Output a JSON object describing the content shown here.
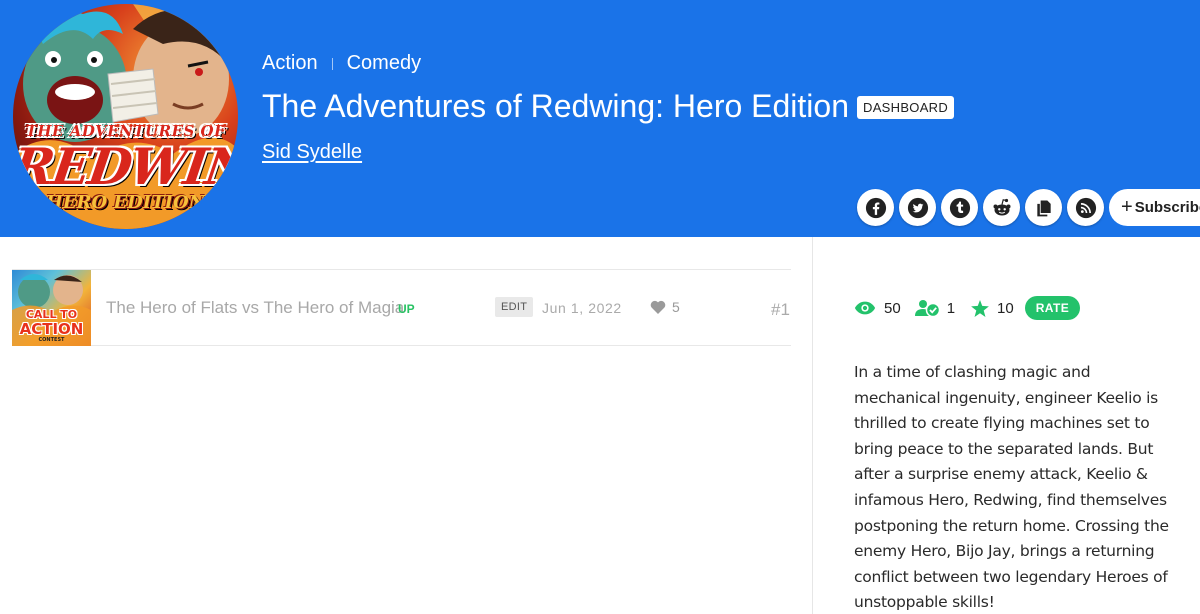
{
  "series": {
    "genres": [
      "Action",
      "Comedy"
    ],
    "title": "The Adventures of Redwing: Hero Edition",
    "dashboard_label": "DASHBOARD",
    "author": "Sid Sydelle",
    "cover_logo": {
      "top": "THE ADVENTURES OF",
      "main": "REDWING",
      "sub": "HERO EDITION"
    }
  },
  "social": {
    "icons": [
      "facebook-icon",
      "twitter-icon",
      "tumblr-icon",
      "reddit-icon",
      "copy-link-icon",
      "rss-icon"
    ],
    "subscribe_label": "Subscribe"
  },
  "episodes": [
    {
      "title": "The Hero of Flats vs The Hero of Magia",
      "badge": "UP",
      "edit_label": "EDIT",
      "date": "Jun 1, 2022",
      "likes": "5",
      "number": "#1",
      "thumb_text": [
        "CALL TO",
        "ACTION",
        "CONTEST"
      ]
    }
  ],
  "stats": {
    "views": "50",
    "subscribers": "1",
    "rating": "10",
    "rate_label": "RATE"
  },
  "description": "In a time of clashing magic and mechanical ingenuity, engineer Keelio is thrilled to create flying machines set to bring peace to the separated lands. But after a surprise enemy attack, Keelio & infamous Hero, Redwing, find themselves postponing the return home. Crossing the enemy Hero, Bijo Jay, brings a returning conflict between two legendary Heroes of unstoppable skills!",
  "colors": {
    "header_bg": "#1a73e8",
    "accent_green": "#23c26b",
    "up_green": "#28c263"
  }
}
